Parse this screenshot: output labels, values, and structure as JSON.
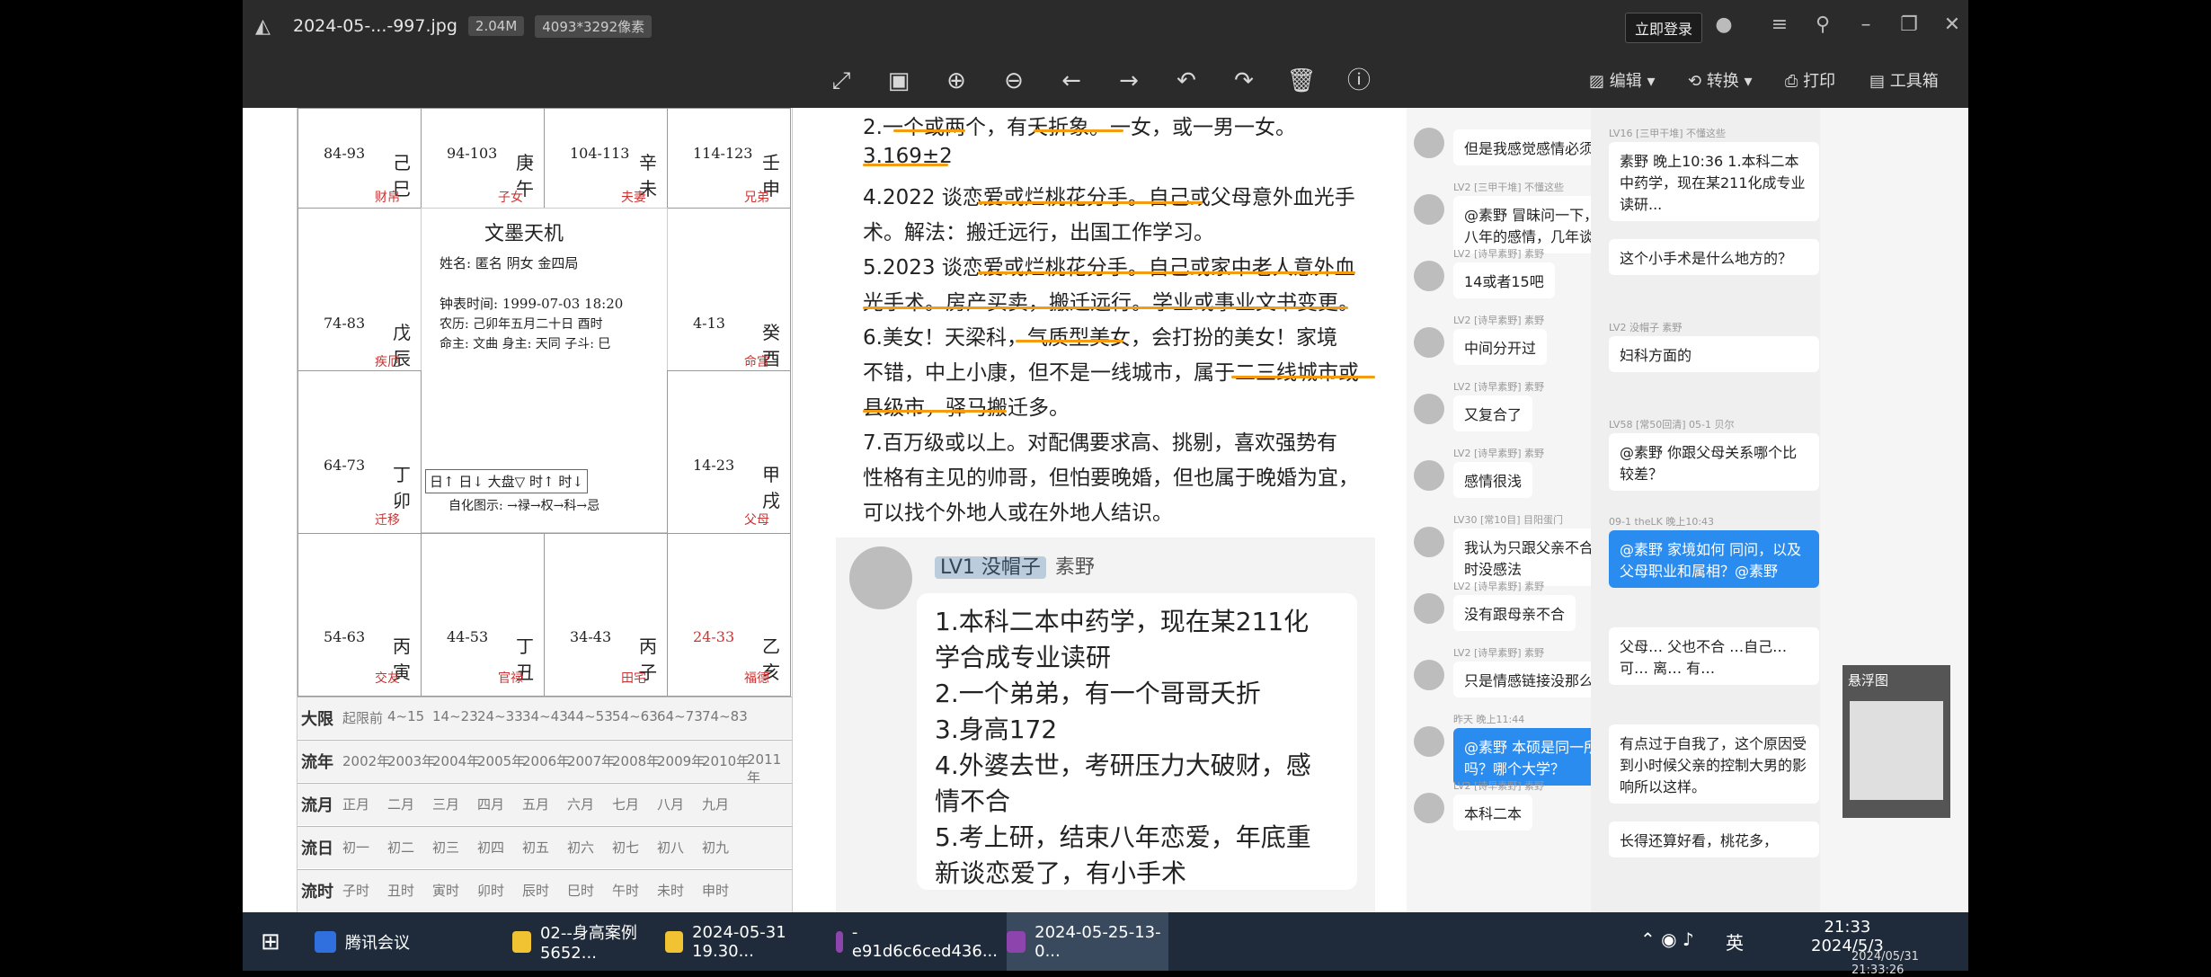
{
  "titlebar": {
    "filename": "2024-05-...-997.jpg",
    "size": "2.04M",
    "pixels": "4093*3292像素",
    "login": "立即登录"
  },
  "toolbar": {
    "edit": "编辑",
    "convert": "转换",
    "print": "打印",
    "tools": "工具箱"
  },
  "chart": {
    "title": "文墨天机",
    "name_line": "姓名: 匿名    阴女 金四局",
    "birth_line": "钟表时间: 1999-07-03 18:20",
    "lunar_line": "农历: 己卯年五月二十日 酉时",
    "ming_line": "命主: 文曲  身主: 天同  子斗: 巳",
    "cells": {
      "c1_stars": "84-93",
      "c1_gz": "己巳",
      "c1_name": "财帛",
      "c2_stars": "94-103",
      "c2_gz": "庚午",
      "c2_name": "子女",
      "c3_stars": "104-113",
      "c3_gz": "辛未",
      "c3_name": "夫妻",
      "c4_stars": "114-123",
      "c4_gz": "壬申",
      "c4_name": "兄弟",
      "c5_stars": "74-83",
      "c5_gz": "戊辰",
      "c5_name": "疾厄",
      "c6_stars": "4-13",
      "c6_gz": "癸酉",
      "c6_name": "命宫",
      "c7_stars": "64-73",
      "c7_gz": "丁卯",
      "c7_name": "迁移",
      "c8_stars": "14-23",
      "c8_gz": "甲戌",
      "c8_name": "父母",
      "c9_stars": "54-63",
      "c9_gz": "丙寅",
      "c9_name": "交友",
      "c10_stars": "44-53",
      "c10_gz": "丁丑",
      "c10_name": "官禄",
      "c11_stars": "34-43",
      "c11_gz": "丙子",
      "c11_name": "田宅",
      "c12_stars": "24-33",
      "c12_gz": "乙亥",
      "c12_name": "福德"
    },
    "arrows": "日↑  日↓  大盘▽  时↑  时↓",
    "legend": "自化图示: →禄→权→科→忌",
    "rows": [
      {
        "label": "大限",
        "cells": [
          "起限前",
          "4~15",
          "14~23",
          "24~33",
          "34~43",
          "44~53",
          "54~63",
          "64~73",
          "74~83"
        ]
      },
      {
        "label": "流年",
        "cells": [
          "2002年",
          "2003年",
          "2004年",
          "2005年",
          "2006年",
          "2007年",
          "2008年",
          "2009年",
          "2010年",
          "2011年"
        ]
      },
      {
        "label": "流月",
        "cells": [
          "正月",
          "二月",
          "三月",
          "四月",
          "五月",
          "六月",
          "七月",
          "八月",
          "九月"
        ]
      },
      {
        "label": "流日",
        "cells": [
          "初一",
          "初二",
          "初三",
          "初四",
          "初五",
          "初六",
          "初七",
          "初八",
          "初九"
        ]
      },
      {
        "label": "流时",
        "cells": [
          "子时",
          "丑时",
          "寅时",
          "卯时",
          "辰时",
          "巳时",
          "午时",
          "未时",
          "申时"
        ]
      }
    ]
  },
  "doc": {
    "lines": [
      "2.一个或两个，有夭折象。一女，或一男一女。",
      "3.169±2",
      "4.2022 谈恋爱或烂桃花分手。自己或父母意外血光手",
      "术。解法：搬迁远行，出国工作学习。",
      "5.2023 谈恋爱或烂桃花分手。自己或家中老人意外血",
      "光手术。房产买卖，搬迁远行。学业或事业文书变更。",
      "6.美女！天梁科，气质型美女，会打扮的美女！家境",
      "不错，中上小康，但不是一线城市，属于二三线城市或",
      "县级市，驿马搬迁多。",
      "7.百万级或以上。对配偶要求高、挑剔，喜欢强势有",
      "性格有主见的帅哥，但怕要晚婚，但也属于晚婚为宜，",
      "可以找个外地人或在外地人结识。"
    ],
    "bubble": {
      "badge": "LV1 没帽子",
      "name": "素野",
      "lines": [
        "1.本科二本中药学，现在某211化",
        "学合成专业读研",
        "2.一个弟弟，有一个哥哥夭折",
        "3.身高172",
        "4.外婆去世，考研压力大破财，感",
        "情不合",
        "5.考上研，结束八年恋爱，年底重",
        "新谈恋爱了，有小手术"
      ]
    }
  },
  "chat": {
    "messages": [
      {
        "meta": "",
        "text": "但是我感觉感情必须忠诚"
      },
      {
        "meta": "LV2 [三甲干堆] 不懂这些",
        "text": "@素野 冒昧问一下，你那个八年的感情，几年谈的？"
      },
      {
        "meta": "LV2 [诗早素野] 素野",
        "text": "14或者15吧"
      },
      {
        "meta": "LV2 [诗早素野] 素野",
        "text": "中间分开过"
      },
      {
        "meta": "LV2 [诗早素野] 素野",
        "text": "又复合了"
      },
      {
        "meta": "LV2 [诗早素野] 素野",
        "text": "感情很浅"
      },
      {
        "meta": "LV30 [常10目] 目阳蛋门",
        "text": "我认为只跟父亲不合，没跟到时没感法"
      },
      {
        "meta": "LV2 [诗早素野] 素野",
        "text": "没有跟母亲不合"
      },
      {
        "meta": "LV2 [诗早素野] 素野",
        "text": "只是情感链接没那么深"
      },
      {
        "meta": "昨天 晚上11:44",
        "text": "@素野 本硕是同一所大学吗？哪个大学？"
      },
      {
        "meta": "LV2 [诗早素野] 素野",
        "text": "本科二本"
      }
    ],
    "side": [
      {
        "meta": "LV16 [三甲干堆] 不懂这些",
        "text": "素野 晚上10:36 1.本科二本中药学，现在某211化成专业读研..."
      },
      {
        "meta": "",
        "text": "这个小手术是什么地方的？"
      },
      {
        "meta": "LV2 没帽子 素野",
        "text": "妇科方面的"
      },
      {
        "meta": "LV58 [常50回清] 05-1 贝尔",
        "text": "@素野 你跟父母关系哪个比较差？"
      },
      {
        "meta": "09-1 theLK 晚上10:43",
        "text": "@素野 家境如何 同问，以及父母职业和属相？@素野"
      },
      {
        "meta": "",
        "text": "父母… 父也不合 …自己… 可… 离… 有…"
      },
      {
        "meta": "",
        "text": "有点过于自我了，这个原因受到小时候父亲的控制大男的影响所以这样。"
      },
      {
        "meta": "",
        "text": "长得还算好看，桃花多，"
      }
    ],
    "popup_title": "悬浮图"
  },
  "taskbar": {
    "items": [
      "腾讯会议",
      "02--身高案例5652...",
      "2024-05-31 19.30...",
      "-e91d6c6ced436...",
      "2024-05-25-13-0..."
    ],
    "time": "21:33",
    "date": "2024/5/3",
    "ime": "英",
    "stamp": "2024/05/31 21:33:26"
  }
}
